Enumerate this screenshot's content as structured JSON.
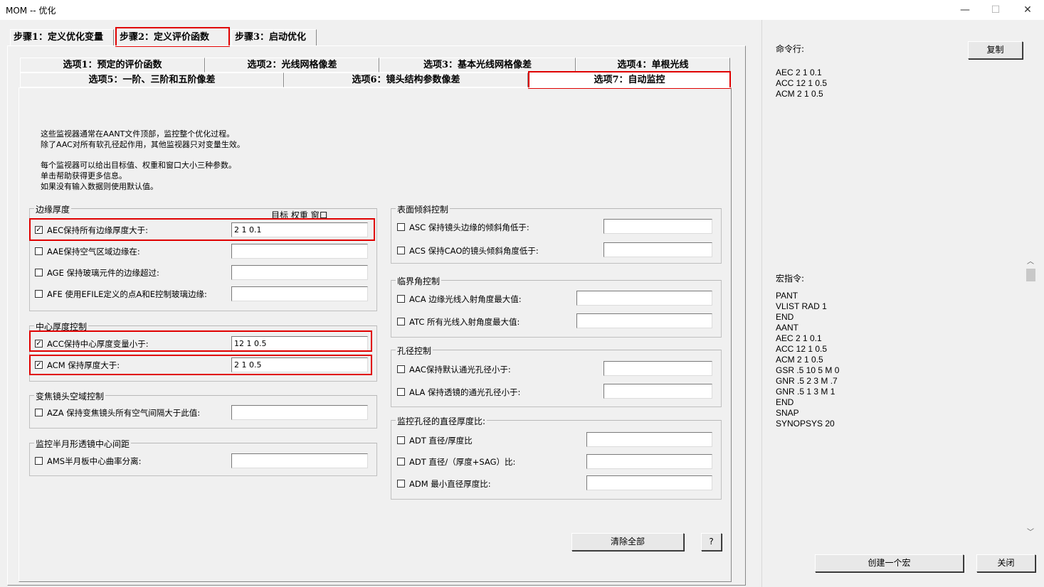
{
  "window": {
    "title": "MOM -- 优化",
    "minimize": "—",
    "maximize": "☐",
    "close": "✕"
  },
  "steps": [
    {
      "label": "步骤1：定义优化变量",
      "selected": false
    },
    {
      "label": "步骤2：定义评价函数",
      "selected": true
    },
    {
      "label": "步骤3：启动优化",
      "selected": false
    }
  ],
  "options_row1": [
    "选项1：预定的评价函数",
    "选项2：光线网格像差",
    "选项3：基本光线网格像差",
    "选项4：单根光线"
  ],
  "options_row2": [
    "选项5：一阶、三阶和五阶像差",
    "选项6：镜头结构参数像差",
    "选项7：自动监控"
  ],
  "info": [
    "这些监视器通常在AANT文件顶部，监控整个优化过程。",
    "除了AAC对所有软孔径起作用，其他监视器只对变量生效。",
    "每个监视器可以给出目标值、权重和窗口大小三种参数。",
    "单击帮助获得更多信息。",
    "如果没有输入数据则使用默认值。"
  ],
  "groups": {
    "edge": {
      "title": "边缘厚度",
      "header": "目标 权重 窗口",
      "rows": [
        {
          "label": "AEC保持所有边缘厚度大于:",
          "checked": true,
          "value": "2 1 0.1"
        },
        {
          "label": "AAE保持空气区域边缘在:",
          "checked": false,
          "value": ""
        },
        {
          "label": "AGE 保持玻璃元件的边缘超过:",
          "checked": false,
          "value": ""
        },
        {
          "label": "AFE 使用EFILE定义的点A和E控制玻璃边缘:",
          "checked": false,
          "value": ""
        }
      ]
    },
    "center": {
      "title": "中心厚度控制",
      "rows": [
        {
          "label": "ACC保持中心厚度变量小于:",
          "checked": true,
          "value": "12 1 0.5"
        },
        {
          "label": "ACM 保持厚度大于:",
          "checked": true,
          "value": "2 1 0.5"
        }
      ]
    },
    "zoom": {
      "title": "变焦镜头空域控制",
      "rows": [
        {
          "label": "AZA 保持变焦镜头所有空气间隔大于此值:",
          "checked": false,
          "value": ""
        }
      ]
    },
    "meniscus": {
      "title": "监控半月形透镜中心间距",
      "rows": [
        {
          "label": "AMS半月板中心曲率分离:",
          "checked": false,
          "value": ""
        }
      ]
    },
    "tilt": {
      "title": "表面倾斜控制",
      "rows": [
        {
          "label": "ASC 保持镜头边缘的倾斜角低于:",
          "checked": false,
          "value": ""
        },
        {
          "label": "ACS 保持CAO的镜头倾斜角度低于:",
          "checked": false,
          "value": ""
        }
      ]
    },
    "critical": {
      "title": "临界角控制",
      "rows": [
        {
          "label": "ACA 边缘光线入射角度最大值:",
          "checked": false,
          "value": ""
        },
        {
          "label": "ATC 所有光线入射角度最大值:",
          "checked": false,
          "value": ""
        }
      ]
    },
    "aperture": {
      "title": "孔径控制",
      "rows": [
        {
          "label": "AAC保持默认通光孔径小于:",
          "checked": false,
          "value": ""
        },
        {
          "label": "ALA 保持透镜的通光孔径小于:",
          "checked": false,
          "value": ""
        }
      ]
    },
    "ratio": {
      "title": "监控孔径的直径厚度比:",
      "rows": [
        {
          "label": "ADT 直径/厚度比",
          "checked": false,
          "value": ""
        },
        {
          "label": "ADT 直径/（厚度+SAG）比:",
          "checked": false,
          "value": ""
        },
        {
          "label": "ADM 最小直径厚度比:",
          "checked": false,
          "value": ""
        }
      ]
    }
  },
  "buttons": {
    "clear_all": "清除全部",
    "help": "?",
    "copy": "复制",
    "create_macro": "创建一个宏",
    "close": "关闭"
  },
  "right": {
    "command_label": "命令行:",
    "commands": [
      "AEC 2 1 0.1",
      "ACC 12 1 0.5",
      "ACM 2 1 0.5"
    ],
    "macro_label": "宏指令:",
    "macro": [
      "PANT",
      "VLIST RAD 1",
      "END",
      "AANT",
      "AEC 2 1 0.1",
      "ACC 12 1 0.5",
      "ACM 2 1 0.5",
      "GSR .5 10 5 M 0",
      "GNR .5 2 3 M .7",
      "GNR .5 1 3 M 1",
      "END",
      "SNAP",
      "SYNOPSYS 20"
    ],
    "scroll_up": "︿",
    "scroll_down": "﹀"
  }
}
